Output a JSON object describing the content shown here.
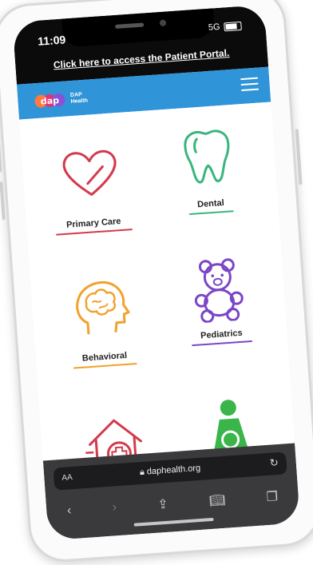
{
  "status_bar": {
    "time": "11:09",
    "network": "5G"
  },
  "banner": {
    "portal_link": "Click here to access the Patient Portal."
  },
  "header": {
    "logo_mark": "dap",
    "logo_line1": "DAP",
    "logo_line2": "Health"
  },
  "services": [
    {
      "label": "Primary Care",
      "icon": "heart-icon",
      "color": "#d33a4c"
    },
    {
      "label": "Dental",
      "icon": "tooth-icon",
      "color": "#38b67c"
    },
    {
      "label": "Behavioral",
      "icon": "brain-head-icon",
      "color": "#f2a12a"
    },
    {
      "label": "Pediatrics",
      "icon": "teddy-bear-icon",
      "color": "#7a46c7"
    },
    {
      "label": "",
      "icon": "house-medical-icon",
      "color": "#d33a4c"
    },
    {
      "label": "",
      "icon": "female-figure-icon",
      "color": "#39b54a"
    }
  ],
  "browser": {
    "text_size_label": "AA",
    "url": "daphealth.org",
    "toolbar_icons": [
      "back-icon",
      "forward-icon",
      "share-icon",
      "bookmarks-icon",
      "tabs-icon"
    ]
  }
}
